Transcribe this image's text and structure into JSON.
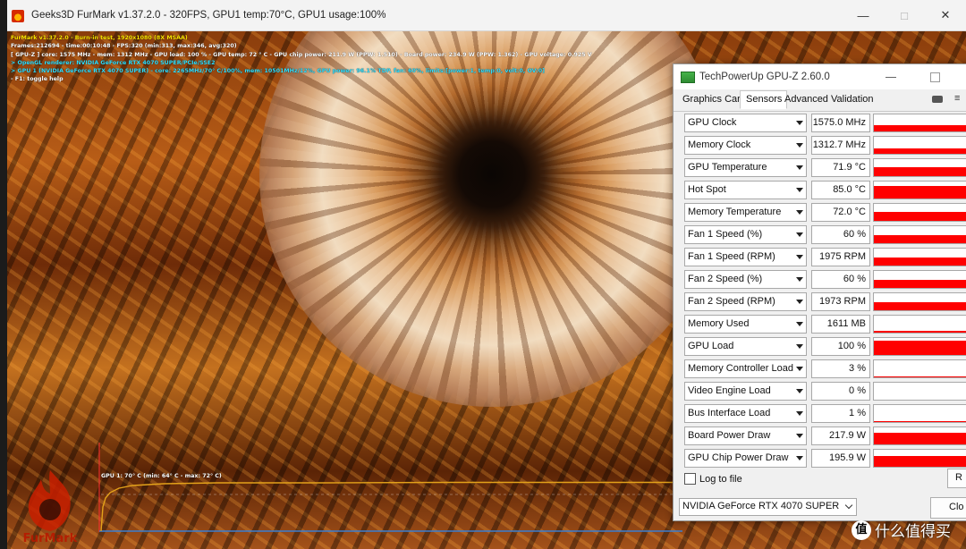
{
  "furmark": {
    "window_title": "Geeks3D FurMark v1.37.2.0 - 320FPS, GPU1 temp:70°C, GPU1 usage:100%",
    "overlay": [
      {
        "text": "FurMark v1.37.2.0 - Burn-in test, 1920x1080 (8X MSAA)",
        "color": "yellow"
      },
      {
        "text": "Frames:212694 - time:00:10:48 - FPS:320 (min:313, max:346, avg:320)",
        "color": "white"
      },
      {
        "text": "[ GPU-Z ] core: 1575 MHz - mem: 1312 MHz - GPU load: 100 % - GPU temp: 72 ° C - GPU chip power: 211.9 W (PPW: 1.510) - Board power: 234.9 W (PPW: 1.362) - GPU voltage: 0.925 V",
        "color": "white"
      },
      {
        "text": "> OpenGL renderer: NVIDIA GeForce RTX 4070 SUPER/PCIe/SSE2",
        "color": "cyan"
      },
      {
        "text": "> GPU 1 (NVIDIA GeForce RTX 4070 SUPER) - core: 2265MHz/70° C/100%, mem: 10501MHz/12%, GPU power: 96.1% TDP, fan: 60%, limits:[power:1, temp:0, volt:0, OV:0]",
        "color": "cyan"
      },
      {
        "text": "- F1: toggle help",
        "color": "white"
      }
    ],
    "graph_label": "GPU 1: 70° C (min: 64° C - max: 72° C)",
    "logo_text": "FurMark"
  },
  "gpuz": {
    "window_title": "TechPowerUp GPU-Z 2.60.0",
    "tabs": [
      "Graphics Card",
      "Sensors",
      "Advanced",
      "Validation"
    ],
    "active_tab": "Sensors",
    "sensors": [
      {
        "name": "GPU Clock",
        "value": "1575.0 MHz",
        "level": 0.35
      },
      {
        "name": "Memory Clock",
        "value": "1312.7 MHz",
        "level": 0.3
      },
      {
        "name": "GPU Temperature",
        "value": "71.9 °C",
        "level": 0.55
      },
      {
        "name": "Hot Spot",
        "value": "85.0 °C",
        "level": 0.75
      },
      {
        "name": "Memory Temperature",
        "value": "72.0 °C",
        "level": 0.55
      },
      {
        "name": "Fan 1 Speed (%)",
        "value": "60 %",
        "level": 0.5
      },
      {
        "name": "Fan 1 Speed (RPM)",
        "value": "1975 RPM",
        "level": 0.5
      },
      {
        "name": "Fan 2 Speed (%)",
        "value": "60 %",
        "level": 0.5
      },
      {
        "name": "Fan 2 Speed (RPM)",
        "value": "1973 RPM",
        "level": 0.5
      },
      {
        "name": "Memory Used",
        "value": "1611 MB",
        "level": 0.12
      },
      {
        "name": "GPU Load",
        "value": "100 %",
        "level": 0.85
      },
      {
        "name": "Memory Controller Load",
        "value": "3 %",
        "level": 0.05
      },
      {
        "name": "Video Engine Load",
        "value": "0 %",
        "level": 0
      },
      {
        "name": "Bus Interface Load",
        "value": "1 %",
        "level": 0.02
      },
      {
        "name": "Board Power Draw",
        "value": "217.9 W",
        "level": 0.7
      },
      {
        "name": "GPU Chip Power Draw",
        "value": "195.9 W",
        "level": 0.65
      }
    ],
    "log_to_file_label": "Log to file",
    "reset_label": "R",
    "gpu_selected": "NVIDIA GeForce RTX 4070 SUPER",
    "close_label": "Clo"
  },
  "watermark": {
    "badge": "值",
    "text": "什么值得买"
  },
  "colors": {
    "graph_fill": "#ff0000",
    "overlay_yellow": "#ffe600",
    "overlay_cyan": "#33e0ff",
    "temp_curve": "#e3a21a"
  }
}
